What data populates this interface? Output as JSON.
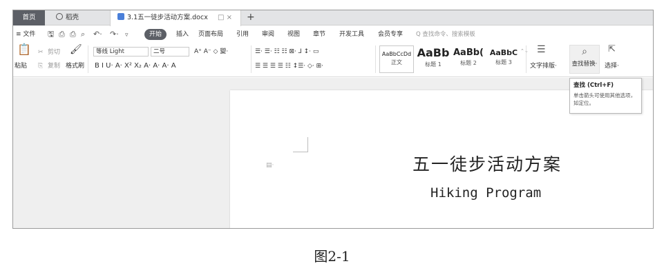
{
  "tabs": {
    "home": "首页",
    "shell": "稻壳",
    "doc": "3.1五一徒步活动方案.docx",
    "doc_ctrl": "□ ×",
    "new_tab": "+"
  },
  "menu": {
    "file": "≡ 文件",
    "start": "开始",
    "items": [
      "插入",
      "页面布局",
      "引用",
      "审阅",
      "视图",
      "章节",
      "开发工具",
      "会员专享"
    ],
    "search": "Q 查找命令、搜索模板"
  },
  "ribbon": {
    "paste": "粘贴",
    "cut": "剪切",
    "copy": "复制",
    "format_painter": "格式刷",
    "font_name": "等线 Light",
    "font_size": "二号",
    "font_tools_row1": "A⁺ A⁻ ◇ 變·",
    "font_tools_row2": "B  I  U·  A·  X²  X₂  A·  A·  A·  A",
    "para_row1": "☰· ☰· ☷ ☷ ⊠· ⅃ ↕· ▭",
    "para_row2": "☰ ☰ ☰ ☰ ☷ ↕☰· ◇· ⊞·",
    "styles": [
      {
        "sample": "AaBbCcDd",
        "name": "正文"
      },
      {
        "sample": "AaBb",
        "name": "标题 1"
      },
      {
        "sample": "AaBb(",
        "name": "标题 2"
      },
      {
        "sample": "AaBbC",
        "name": "标题 3"
      }
    ],
    "text_layout": "文字排版·",
    "find_replace": "查找替换·",
    "select": "选择·"
  },
  "tooltip": {
    "title": "查找 (Ctrl+F)",
    "desc": "单击箭头可使用其他选项，如定位。"
  },
  "document": {
    "title": "五一徒步活动方案",
    "subtitle": "Hiking Program"
  },
  "caption": "图2-1"
}
